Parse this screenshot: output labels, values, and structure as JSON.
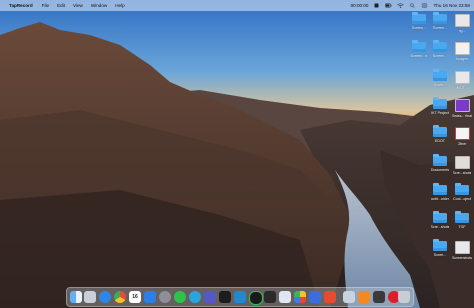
{
  "menubar": {
    "apple_glyph": "",
    "app_name": "TapRecord",
    "items": [
      "File",
      "Edit",
      "View",
      "Window",
      "Help"
    ],
    "record_time": "00:00:00",
    "clock": "Thu 16 Nov 23:58"
  },
  "desktop_icons": [
    {
      "label": "Screen...",
      "kind": "folder"
    },
    {
      "label": "Screen...",
      "kind": "folder"
    },
    {
      "label": "bg...",
      "kind": "file"
    },
    {
      "label": "Screen...n",
      "kind": "folder"
    },
    {
      "label": "Screen...",
      "kind": "folder"
    },
    {
      "label": "Images",
      "kind": "file"
    },
    {
      "label": "Scree...",
      "kind": "folder"
    },
    {
      "label": "MOT...",
      "kind": "file"
    },
    {
      "label": "IKT Project",
      "kind": "folder"
    },
    {
      "label": "Swiss... final",
      "kind": "file"
    },
    {
      "label": "EDOT",
      "kind": "folder"
    },
    {
      "label": "Other",
      "kind": "file"
    },
    {
      "label": "Documents",
      "kind": "folder"
    },
    {
      "label": "Scre...shots",
      "kind": "file"
    },
    {
      "label": "untit...older",
      "kind": "folder"
    },
    {
      "label": "Cool...oject",
      "kind": "folder"
    },
    {
      "label": "Scre...shots",
      "kind": "folder"
    },
    {
      "label": "TGF",
      "kind": "folder"
    },
    {
      "label": "Scree...",
      "kind": "folder"
    },
    {
      "label": "Screenshots",
      "kind": "file"
    }
  ],
  "dock_apps": [
    "finder-icon",
    "launchpad-icon",
    "safari-icon",
    "chrome-icon",
    "calendar-icon",
    "app-store-icon",
    "settings-icon",
    "whatsapp-icon",
    "telegram-icon",
    "teams-icon",
    "terminal-icon",
    "vscode-icon",
    "xcode-icon",
    "spotify-icon",
    "zoom-icon",
    "notes-icon",
    "photos-icon",
    "pages-icon",
    "preview-icon",
    "illustrator-icon",
    "sublime-icon",
    "recorder-icon",
    "trash-icon"
  ],
  "calendar_day": "16",
  "colors": {
    "sky_top": "#3a77c5",
    "sky_horizon": "#f0b574",
    "folder": "#4aa8f0",
    "river": "#8ba5c4"
  }
}
